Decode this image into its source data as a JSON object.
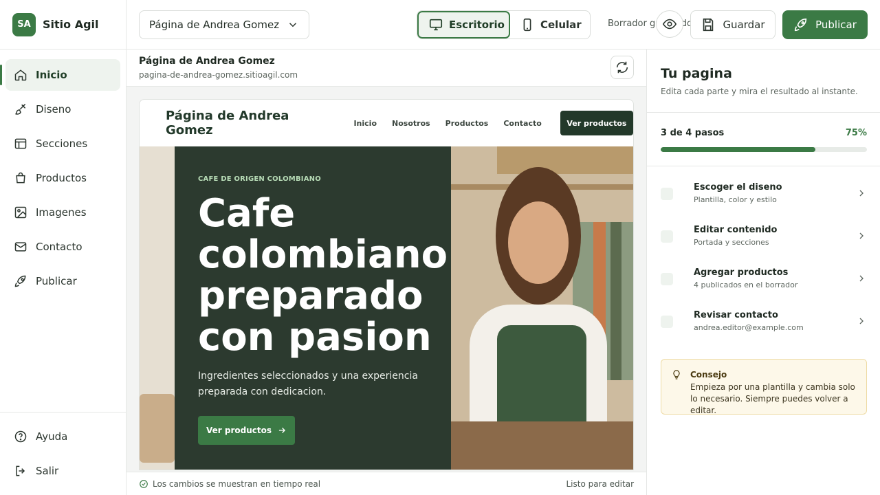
{
  "app": {
    "badge": "SA",
    "name": "Sitio Agil"
  },
  "sidebar": {
    "items": [
      {
        "label": "Inicio",
        "icon": "home-icon"
      },
      {
        "label": "Diseno",
        "icon": "brush-icon"
      },
      {
        "label": "Secciones",
        "icon": "layout-icon"
      },
      {
        "label": "Productos",
        "icon": "bag-icon"
      },
      {
        "label": "Imagenes",
        "icon": "images-icon"
      },
      {
        "label": "Contacto",
        "icon": "mail-icon"
      },
      {
        "label": "Publicar",
        "icon": "rocket-icon"
      }
    ],
    "bottom": [
      {
        "label": "Ayuda",
        "icon": "help-icon"
      },
      {
        "label": "Salir",
        "icon": "logout-icon"
      }
    ]
  },
  "topbar": {
    "page_select": "Página de Andrea Gomez",
    "device_desktop": "Escritorio",
    "device_mobile": "Celular",
    "status": "Borrador guardado",
    "save_label": "Guardar",
    "publish_label": "Publicar"
  },
  "preview": {
    "title": "Página de Andrea Gomez",
    "url": "pagina-de-andrea-gomez.sitioagil.com",
    "footer_status": "Los cambios se muestran en tiempo real",
    "footer_ready": "Listo para editar"
  },
  "site": {
    "title": "Página de Andrea Gomez",
    "nav": [
      "Inicio",
      "Nosotros",
      "Productos",
      "Contacto"
    ],
    "cta": "Ver productos",
    "eyebrow": "CAFE DE ORIGEN COLOMBIANO",
    "heading": "Cafe colombiano preparado con pasion",
    "sub": "Ingredientes seleccionados y una experiencia preparada con dedicacion.",
    "hero_button": "Ver productos"
  },
  "panel": {
    "title": "Tu pagina",
    "subtitle": "Edita cada parte y mira el resultado al instante.",
    "progress_label": "3 de 4 pasos",
    "progress_pct": "75%",
    "progress_fraction": 0.75,
    "steps": [
      {
        "title": "Escoger el diseno",
        "desc": "Plantilla, color y estilo"
      },
      {
        "title": "Editar contenido",
        "desc": "Portada y secciones"
      },
      {
        "title": "Agregar productos",
        "desc": "4 publicados en el borrador"
      },
      {
        "title": "Revisar contacto",
        "desc": "andrea.editor@example.com"
      }
    ],
    "tip_title": "Consejo",
    "tip_text": "Empieza por una plantilla y cambia solo lo necesario. Siempre puedes volver a editar."
  },
  "colors": {
    "accent": "#3b7a45",
    "hero_panel": "#2c3a2f",
    "site_cta": "#23392a",
    "tip_bg": "#fdf8e9"
  }
}
